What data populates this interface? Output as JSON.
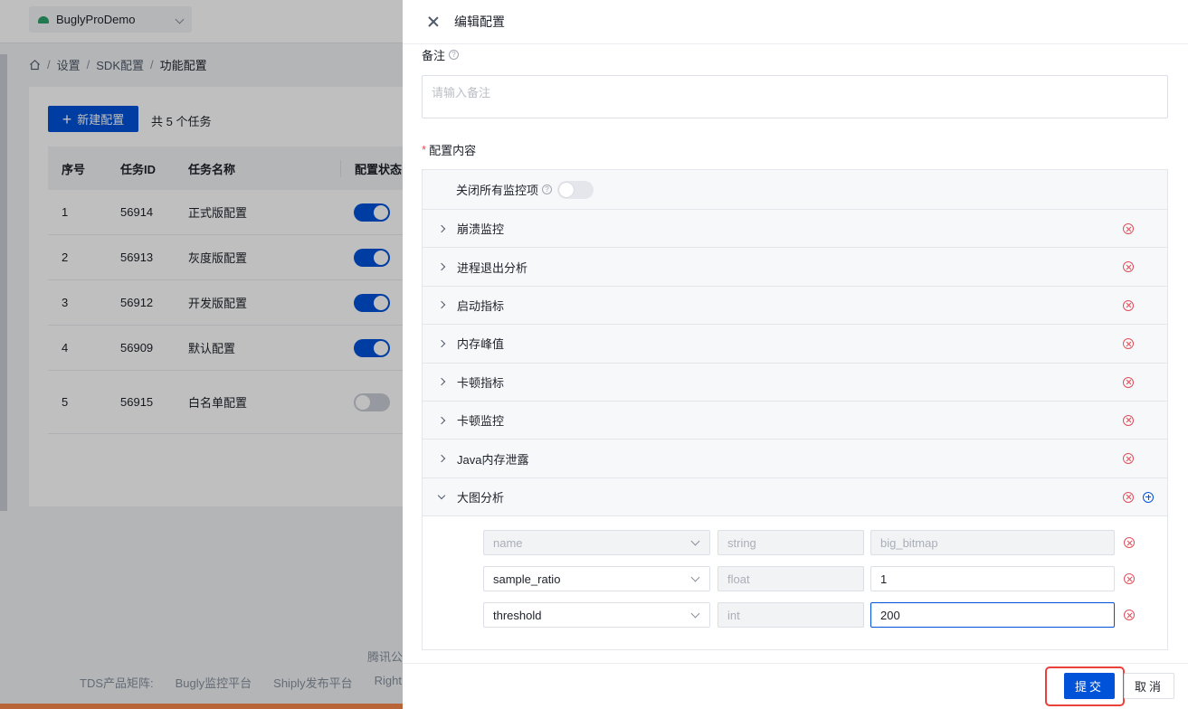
{
  "topbar": {
    "app_name": "BuglyProDemo"
  },
  "breadcrumb": [
    "设置",
    "SDK配置",
    "功能配置"
  ],
  "toolbar": {
    "new_label": "新建配置",
    "total_text": "共 5 个任务"
  },
  "table": {
    "columns": [
      "序号",
      "任务ID",
      "任务名称",
      "配置状态"
    ],
    "rows": [
      {
        "index": "1",
        "id": "56914",
        "name": "正式版配置",
        "enabled": true
      },
      {
        "index": "2",
        "id": "56913",
        "name": "灰度版配置",
        "enabled": true
      },
      {
        "index": "3",
        "id": "56912",
        "name": "开发版配置",
        "enabled": true
      },
      {
        "index": "4",
        "id": "56909",
        "name": "默认配置",
        "enabled": true
      },
      {
        "index": "5",
        "id": "56915",
        "name": "白名单配置",
        "enabled": false
      }
    ]
  },
  "footer": {
    "company": "腾讯公",
    "matrix_label": "TDS产品矩阵:",
    "links": [
      "Bugly监控平台",
      "Shiply发布平台",
      "Right"
    ]
  },
  "drawer": {
    "title": "编辑配置",
    "remark_label": "备注",
    "remark_placeholder": "请输入备注",
    "config_label": "配置内容",
    "close_all_label": "关闭所有监控项",
    "panels": [
      "崩溃监控",
      "进程退出分析",
      "启动指标",
      "内存峰值",
      "卡顿指标",
      "卡顿监控",
      "Java内存泄露",
      "大图分析"
    ],
    "params": [
      {
        "key": "name",
        "type": "string",
        "value": "big_bitmap"
      },
      {
        "key": "sample_ratio",
        "type": "float",
        "value": "1"
      },
      {
        "key": "threshold",
        "type": "int",
        "value": "200"
      }
    ],
    "submit_label": "提交",
    "cancel_label": "取消"
  }
}
